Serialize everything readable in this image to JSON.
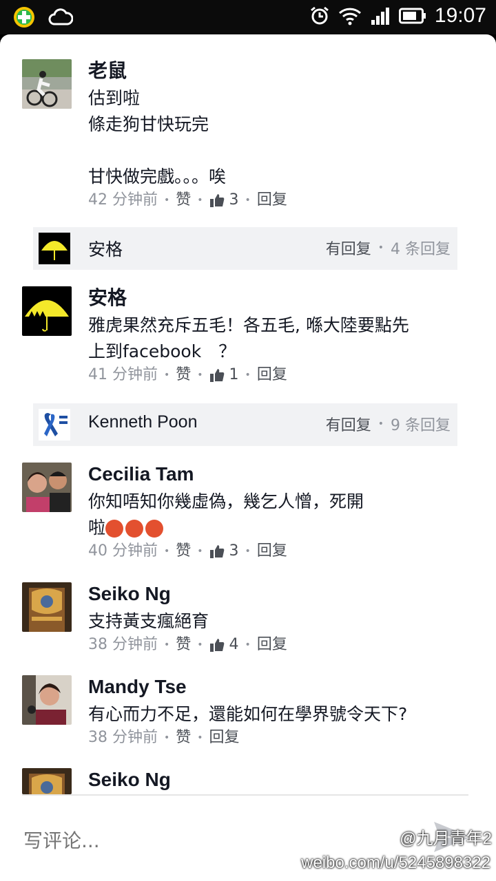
{
  "status": {
    "time": "19:07",
    "icons": [
      "app-badge-icon",
      "cloud-icon",
      "alarm-icon",
      "wifi-icon",
      "signal-icon",
      "battery-icon"
    ]
  },
  "comments": [
    {
      "name": "老鼠",
      "lines": [
        "估到啦",
        "條走狗甘快玩完",
        "",
        "甘快做完戲。。。唉"
      ],
      "time": "42 分钟前",
      "like": "赞",
      "likes": "3",
      "reply": "回复"
    },
    {
      "name": "安格",
      "lines": [
        "雅虎果然充斥五毛！各五毛, 喺大陸要點先",
        "上到facebook　？"
      ],
      "time": "41 分钟前",
      "like": "赞",
      "likes": "1",
      "reply": "回复"
    },
    {
      "name": "Cecilia Tam",
      "lines": [
        "你知唔知你幾虛偽，幾乞人憎，死開",
        "啦"
      ],
      "time": "40 分钟前",
      "like": "赞",
      "likes": "3",
      "reply": "回复"
    },
    {
      "name": "Seiko Ng",
      "lines": [
        "支持黃支瘋絕育"
      ],
      "time": "38 分钟前",
      "like": "赞",
      "likes": "4",
      "reply": "回复"
    },
    {
      "name": "Mandy Tse",
      "lines": [
        "有心而力不足，還能如何在學界號令天下?"
      ],
      "time": "38 分钟前",
      "like": "赞",
      "reply": "回复"
    },
    {
      "name": "Seiko Ng"
    }
  ],
  "replies": [
    {
      "name": "安格",
      "has_reply": "有回复",
      "count": "4 条回复"
    },
    {
      "name": "Kenneth Poon",
      "has_reply": "有回复",
      "count": "9 条回复"
    }
  ],
  "input": {
    "placeholder": "写评论..."
  },
  "watermark": {
    "handle": "@九月青年2",
    "url": "weibo.com/u/5245898322"
  },
  "colors": {
    "text": "#141823",
    "muted": "#90949c",
    "link": "#4b4f56",
    "reply_bg": "#f1f2f4",
    "umbrella_yellow": "#f4e92a"
  }
}
